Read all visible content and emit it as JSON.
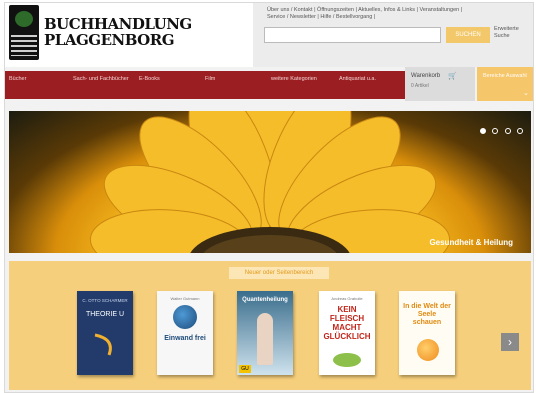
{
  "brand": {
    "name_line1": "BUCHHANDLUNG",
    "name_line2": "PLAGGENBORG"
  },
  "topbar": {
    "links_line1": "Über uns / Kontakt | Öffnungszeiten | Aktuelles, Infos & Links | Veranstaltungen |",
    "links_line2": "Service / Newsletter | Hilfe / Bestellvorgang |",
    "search_button": "SUCHEN",
    "advanced_search": "Erweiterte Suche"
  },
  "nav": {
    "items": [
      "Bücher",
      "Sach- und Fachbücher",
      "E-Books",
      "Film",
      "weitere Kategorien",
      "Antiquariat u.a."
    ]
  },
  "cart": {
    "label": "Warenkorb",
    "count": "0 Artikel"
  },
  "topic": {
    "label": "Bereiche Auswahl"
  },
  "hero": {
    "caption": "Gesundheit & Heilung"
  },
  "books": {
    "section_title": "Neuer oder Seitenbereich",
    "items": [
      {
        "title": "THEORIE U",
        "author": "C. OTTO SCHARMER"
      },
      {
        "title": "Einwand frei",
        "author": "Walter Gutmann"
      },
      {
        "title": "Quantenheilung",
        "author": ""
      },
      {
        "title": "KEIN FLEISCH MACHT GLÜCKLICH",
        "author": "Andreas Grabolle"
      },
      {
        "title": "In die Welt der Seele schauen",
        "author": ""
      }
    ]
  },
  "colors": {
    "nav_red": "#9b1e22",
    "accent_orange": "#f3c86a"
  }
}
